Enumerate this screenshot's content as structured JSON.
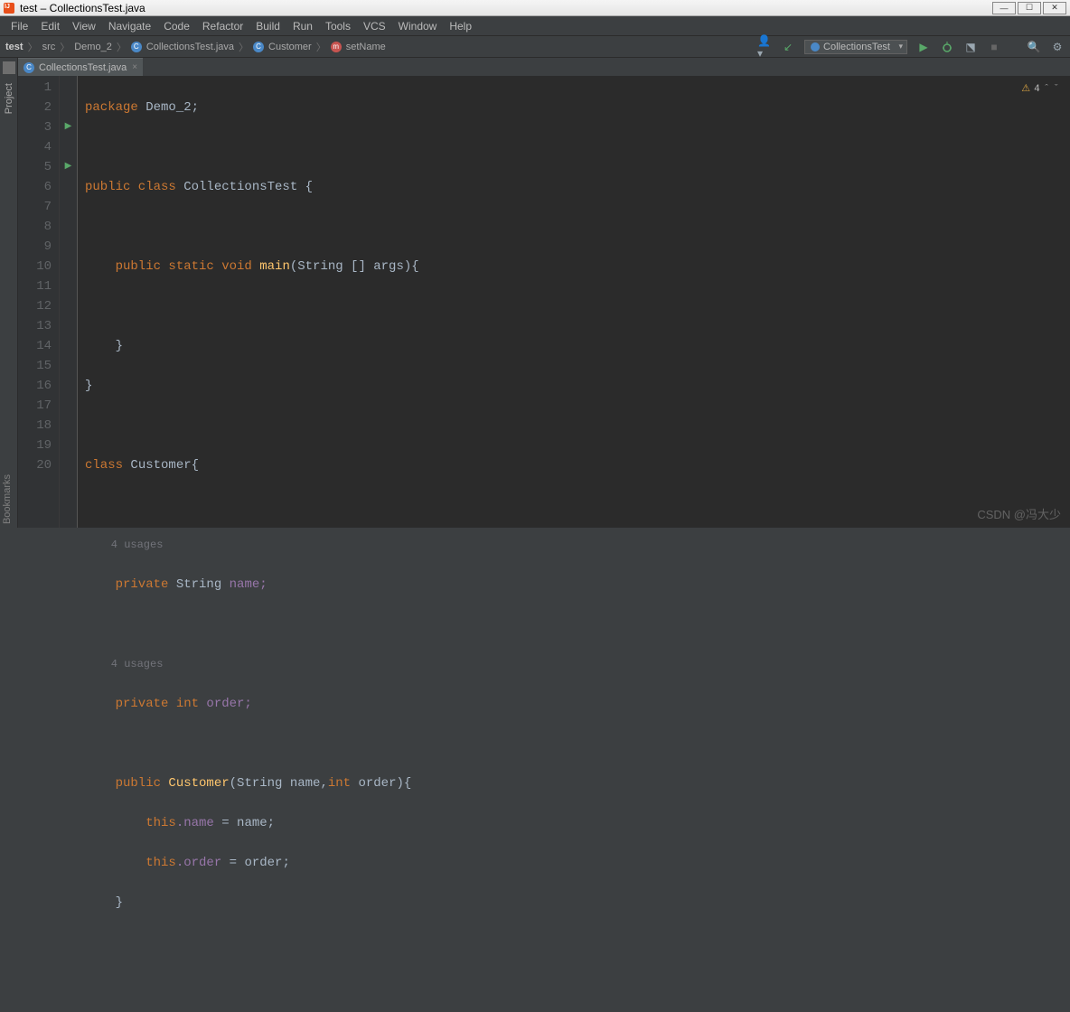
{
  "window": {
    "title": "test – CollectionsTest.java"
  },
  "menus": [
    "File",
    "Edit",
    "View",
    "Navigate",
    "Code",
    "Refactor",
    "Build",
    "Run",
    "Tools",
    "VCS",
    "Window",
    "Help"
  ],
  "breadcrumb": {
    "project": "test",
    "src": "src",
    "pkg": "Demo_2",
    "file": "CollectionsTest.java",
    "class": "Customer",
    "method": "setName"
  },
  "runConfig": "CollectionsTest",
  "tab": {
    "name": "CollectionsTest.java"
  },
  "sidePanel": {
    "project": "Project",
    "bookmarks": "Bookmarks"
  },
  "inspector": {
    "warnCount": "4"
  },
  "code": {
    "l1a": "package",
    "l1b": " Demo_2;",
    "l3a": "public class ",
    "l3b": "CollectionsTest {",
    "l5a": "    public static void ",
    "l5b": "main",
    "l5c": "(String [] args){",
    "l7": "    }",
    "l8": "}",
    "l10a": "class ",
    "l10b": "Customer{",
    "hint": "    4 usages",
    "l12a": "    private ",
    "l12b": "String ",
    "l12c": "name;",
    "l14a": "    private int ",
    "l14b": "order;",
    "l16a": "    public ",
    "l16b": "Customer",
    "l16c": "(String name,",
    "l16d": "int",
    "l16e": " order){",
    "l17a": "        this",
    "l17b": ".name",
    "l17c": " = name;",
    "l18a": "        this",
    "l18b": ".order",
    "l18c": " = order;",
    "l19": "    }"
  },
  "lineNumbers": [
    "1",
    "2",
    "3",
    "4",
    "5",
    "6",
    "7",
    "8",
    "9",
    "10",
    "11",
    "",
    "12",
    "13",
    "",
    "14",
    "15",
    "16",
    "17",
    "18",
    "19",
    "20"
  ],
  "watermark": "CSDN @冯大少"
}
